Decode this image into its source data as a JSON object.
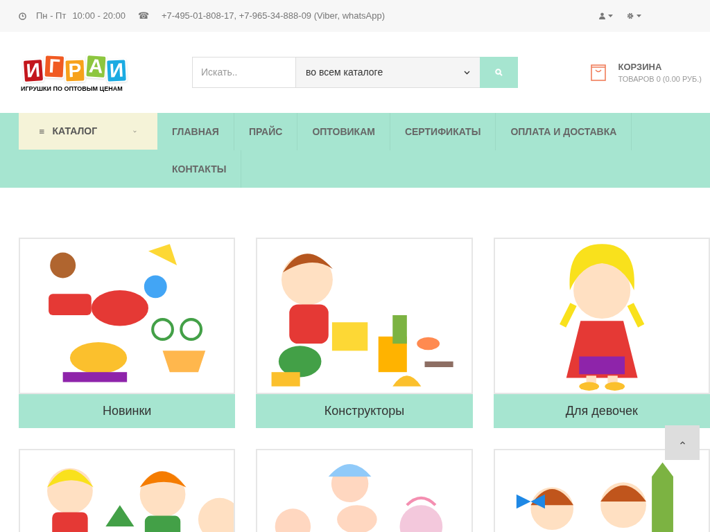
{
  "top_bar": {
    "days": "Пн - Пт",
    "hours": "10:00 - 20:00",
    "phone_icon": "☎",
    "phones": "+7-495-01-808-17, +7-965-34-888-09 (Viber, whatsApp)"
  },
  "logo": {
    "letters": [
      "И",
      "Г",
      "Р",
      "А",
      "И"
    ],
    "tagline": "ИГРУШКИ ПО ОПТОВЫМ ЦЕНАМ"
  },
  "search": {
    "placeholder": "Искать..",
    "category": "во всем каталоге"
  },
  "cart": {
    "title": "КОРЗИНА",
    "summary": "ТОВАРОВ 0 (0.00 РУБ.)"
  },
  "nav": {
    "catalog": "КАТАЛОГ",
    "items": [
      "ГЛАВНАЯ",
      "ПРАЙС",
      "ОПТОВИКАМ",
      "СЕРТИФИКАТЫ",
      "ОПЛАТА И ДОСТАВКА",
      "КОНТАКТЫ"
    ]
  },
  "categories": [
    {
      "kind": "category",
      "title": "Новинки"
    },
    {
      "kind": "category",
      "title": "Конструкторы"
    },
    {
      "kind": "category",
      "title": "Для девочек"
    },
    {
      "kind": "picture"
    },
    {
      "kind": "picture"
    },
    {
      "kind": "picture"
    }
  ]
}
